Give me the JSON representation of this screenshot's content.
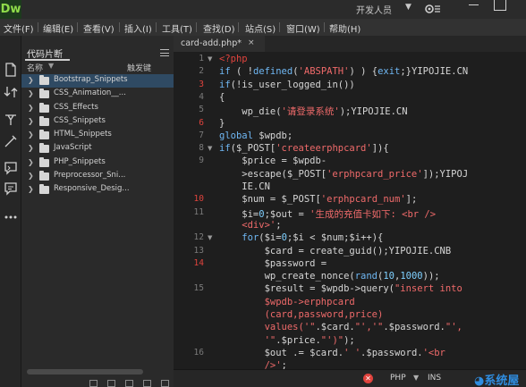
{
  "app": {
    "logo": "Dw",
    "workspace": "开发人员",
    "workspace_caret": "▼"
  },
  "menu": [
    "文件(F)",
    "编辑(E)",
    "查看(V)",
    "插入(I)",
    "工具(T)",
    "查找(D)",
    "站点(S)",
    "窗口(W)",
    "帮助(H)"
  ],
  "panel": {
    "tab": "代码片断",
    "col_name": "名称",
    "col_sort": "▼",
    "col_shortcut": "触发键",
    "items": [
      "Bootstrap_Snippets",
      "CSS_Animation__...",
      "CSS_Effects",
      "CSS_Snippets",
      "HTML_Snippets",
      "JavaScript",
      "PHP_Snippets",
      "Preprocessor_Sni...",
      "Responsive_Desig..."
    ],
    "selected_index": 0
  },
  "editor": {
    "tab_label": "card-add.php*",
    "tab_close": "×",
    "gutter": [
      {
        "n": "1",
        "err": false,
        "fold": "▼"
      },
      {
        "n": "2",
        "err": false,
        "fold": ""
      },
      {
        "n": "3",
        "err": true,
        "fold": ""
      },
      {
        "n": "4",
        "err": false,
        "fold": ""
      },
      {
        "n": "5",
        "err": false,
        "fold": ""
      },
      {
        "n": "6",
        "err": true,
        "fold": ""
      },
      {
        "n": "7",
        "err": false,
        "fold": ""
      },
      {
        "n": "8",
        "err": false,
        "fold": "▼"
      },
      {
        "n": "9",
        "err": false,
        "fold": ""
      },
      {
        "n": "",
        "err": false,
        "fold": ""
      },
      {
        "n": "",
        "err": false,
        "fold": ""
      },
      {
        "n": "10",
        "err": true,
        "fold": ""
      },
      {
        "n": "11",
        "err": false,
        "fold": ""
      },
      {
        "n": "",
        "err": false,
        "fold": ""
      },
      {
        "n": "12",
        "err": false,
        "fold": "▼"
      },
      {
        "n": "13",
        "err": false,
        "fold": ""
      },
      {
        "n": "14",
        "err": true,
        "fold": ""
      },
      {
        "n": "",
        "err": false,
        "fold": ""
      },
      {
        "n": "15",
        "err": false,
        "fold": ""
      },
      {
        "n": "",
        "err": false,
        "fold": ""
      },
      {
        "n": "",
        "err": false,
        "fold": ""
      },
      {
        "n": "",
        "err": false,
        "fold": ""
      },
      {
        "n": "",
        "err": false,
        "fold": ""
      },
      {
        "n": "16",
        "err": false,
        "fold": ""
      },
      {
        "n": "",
        "err": false,
        "fold": ""
      }
    ],
    "code": [
      [
        [
          "t-php",
          "<?php"
        ]
      ],
      [
        [
          "t-kw",
          "if"
        ],
        [
          "",
          " ( !"
        ],
        [
          "t-kw",
          "defined"
        ],
        [
          "",
          "("
        ],
        [
          "t-str",
          "'ABSPATH'"
        ],
        [
          "",
          ") ) {"
        ],
        [
          "t-kw",
          "exit"
        ],
        [
          "",
          ";}YIPOJIE.CN"
        ]
      ],
      [
        [
          "t-kw",
          "if"
        ],
        [
          "",
          "(!is_user_logged_in())"
        ]
      ],
      [
        [
          "",
          "{"
        ]
      ],
      [
        [
          "",
          "    wp_die("
        ],
        [
          "t-str",
          "'请登录系统'"
        ],
        [
          "",
          ");YIPOJIE.CN"
        ]
      ],
      [
        [
          "",
          "}"
        ]
      ],
      [
        [
          "t-kw",
          "global"
        ],
        [
          "",
          " $wpdb;"
        ]
      ],
      [
        [
          "t-kw",
          "if"
        ],
        [
          "",
          "($_POST["
        ],
        [
          "t-str",
          "'createerphpcard'"
        ],
        [
          "",
          "]){"
        ]
      ],
      [
        [
          "",
          "    $price = $wpdb-"
        ]
      ],
      [
        [
          "",
          "    >escape($_POST["
        ],
        [
          "t-str",
          "'erphpcard_price'"
        ],
        [
          "",
          "]);YIPOJ"
        ]
      ],
      [
        [
          "",
          "    IE.CN"
        ]
      ],
      [
        [
          "",
          "    $num = $_POST["
        ],
        [
          "t-str",
          "'erphpcard_num'"
        ],
        [
          "",
          "];"
        ]
      ],
      [
        [
          "",
          "    $i="
        ],
        [
          "t-num",
          "0"
        ],
        [
          "",
          ";$out = "
        ],
        [
          "t-str",
          "'生成的充值卡如下: <br />"
        ]
      ],
      [
        [
          "t-str",
          "    <div>'"
        ],
        [
          "",
          ";"
        ]
      ],
      [
        [
          "",
          "    "
        ],
        [
          "t-kw",
          "for"
        ],
        [
          "",
          "($i="
        ],
        [
          "t-num",
          "0"
        ],
        [
          "",
          ";$i < $num;$i++){"
        ]
      ],
      [
        [
          "",
          "        $card = create_guid();YIPOJIE.CNB"
        ]
      ],
      [
        [
          "",
          "        $password ="
        ]
      ],
      [
        [
          "",
          "        wp_create_nonce("
        ],
        [
          "t-kw",
          "rand"
        ],
        [
          "",
          "("
        ],
        [
          "t-num",
          "10"
        ],
        [
          "",
          ","
        ],
        [
          "t-num",
          "1000"
        ],
        [
          "",
          "));"
        ]
      ],
      [
        [
          "",
          "        $result = $wpdb->query("
        ],
        [
          "t-str",
          "\"insert into"
        ]
      ],
      [
        [
          "t-str",
          "        $wpdb->erphpcard"
        ]
      ],
      [
        [
          "t-str",
          "        (card,password,price)"
        ]
      ],
      [
        [
          "t-str",
          "        values('\""
        ],
        [
          "",
          ".$card."
        ],
        [
          "t-str",
          "\"','\""
        ],
        [
          "",
          ".$password."
        ],
        [
          "t-str",
          "\"',"
        ]
      ],
      [
        [
          "t-str",
          "        '\""
        ],
        [
          "",
          ".$price."
        ],
        [
          "t-str",
          "\"')\""
        ],
        [
          "",
          ");"
        ]
      ],
      [
        [
          "",
          "        $out .= $card."
        ],
        [
          "t-str",
          "' '"
        ],
        [
          "",
          ".$password."
        ],
        [
          "t-str",
          "'<br"
        ]
      ],
      [
        [
          "t-str",
          "        />'"
        ],
        [
          "",
          ";"
        ]
      ]
    ]
  },
  "status": {
    "error_glyph": "✕",
    "language": "PHP",
    "language_caret": "▼",
    "mode": "INS",
    "watermark": "◕系统屋"
  },
  "colors": {
    "accent_logo": "#8fdc4a",
    "selection": "#2f4a63",
    "error": "#e0433d",
    "keyword": "#6fb7f3",
    "string": "#ef6a6a"
  }
}
